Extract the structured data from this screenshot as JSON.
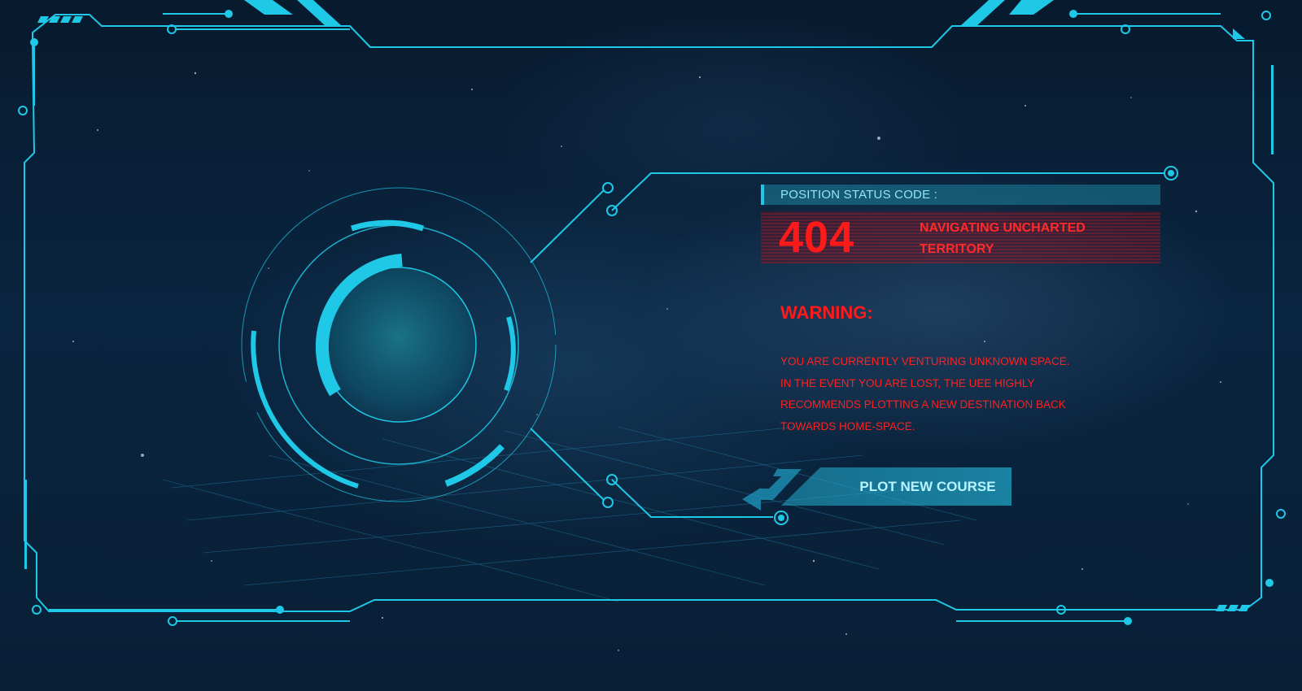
{
  "status": {
    "header_label": "POSITION STATUS CODE :",
    "error_code": "404",
    "error_message": "NAVIGATING UNCHARTED TERRITORY"
  },
  "warning": {
    "title": "WARNING:",
    "lines": [
      "YOU ARE CURRENTLY VENTURING UNKNOWN SPACE.",
      "IN THE EVENT YOU ARE LOST, THE UEE HIGHLY",
      "RECOMMENDS PLOTTING A NEW DESTINATION BACK",
      "TOWARDS HOME-SPACE."
    ]
  },
  "actions": {
    "plot_course_label": "PLOT NEW COURSE"
  },
  "colors": {
    "hud_cyan": "#1ec8e6",
    "alert_red": "#ff1a1a",
    "space_bg": "#0a2540"
  },
  "icons": {
    "scanner": "radar-ring-icon",
    "back_arrow": "return-arrow-icon"
  }
}
